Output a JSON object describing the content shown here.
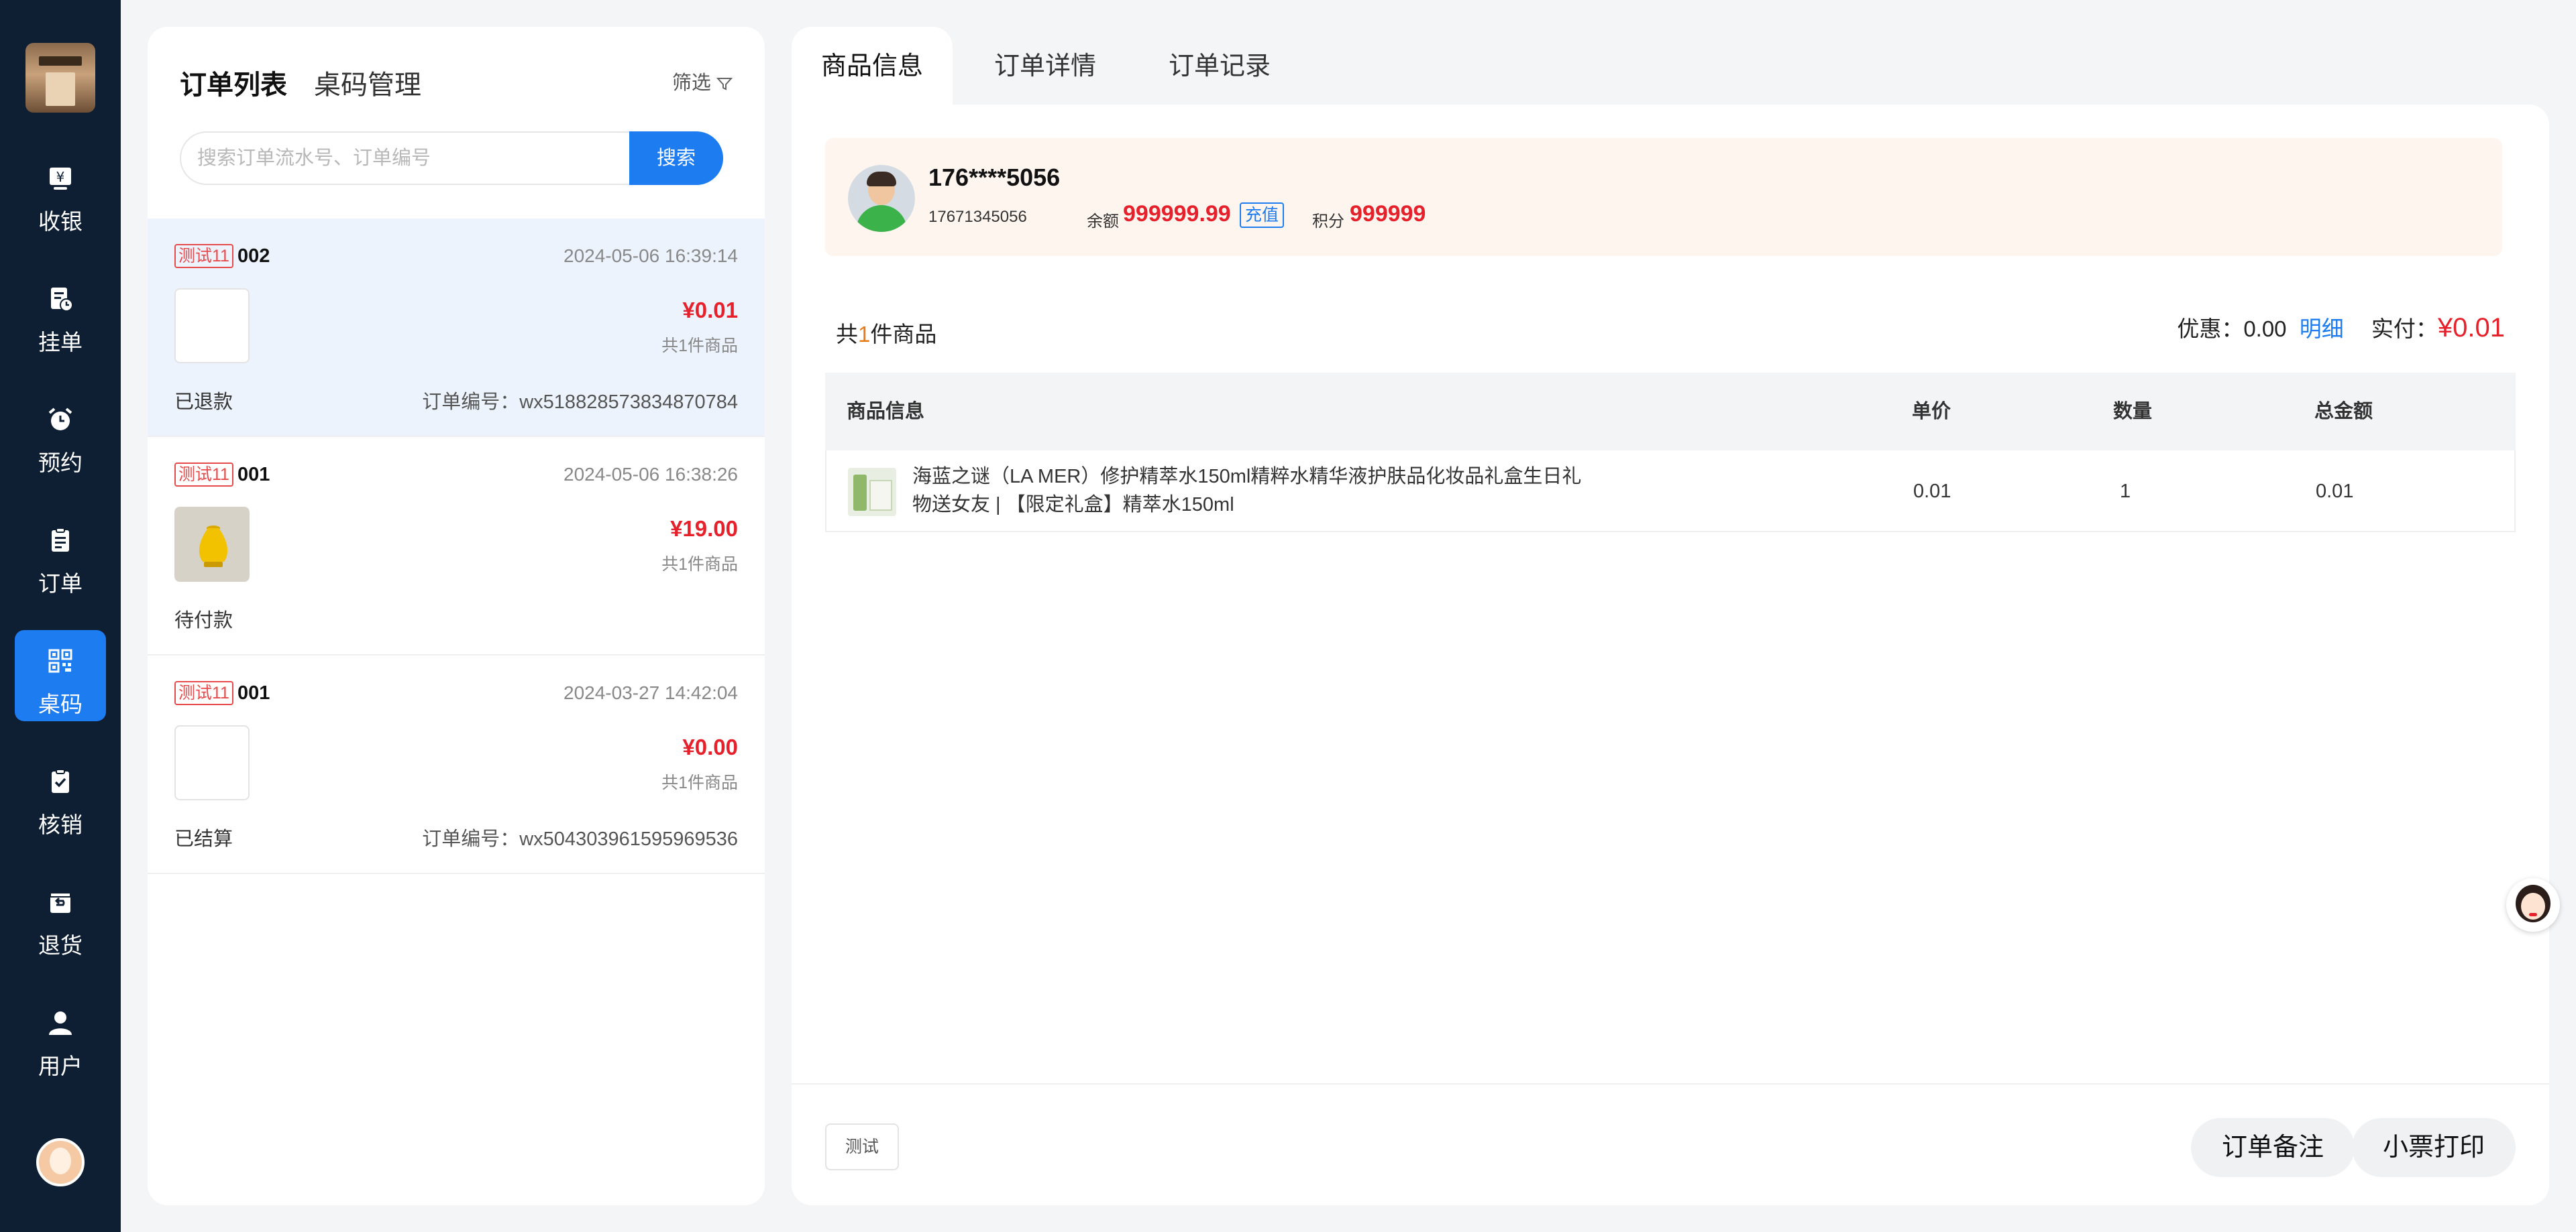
{
  "colors": {
    "accent": "#1c7cf0",
    "price": "#e6212b",
    "nav_bg": "#0f1f33",
    "member_bg": "#fff5ef"
  },
  "nav": {
    "items": [
      {
        "label": "收银",
        "icon": "cashier-yen-icon"
      },
      {
        "label": "挂单",
        "icon": "pending-order-icon"
      },
      {
        "label": "预约",
        "icon": "alarm-clock-icon"
      },
      {
        "label": "订单",
        "icon": "order-clipboard-icon"
      },
      {
        "label": "桌码",
        "icon": "qr-code-icon"
      },
      {
        "label": "核销",
        "icon": "verify-clipboard-icon"
      },
      {
        "label": "退货",
        "icon": "return-icon"
      },
      {
        "label": "用户",
        "icon": "user-icon"
      }
    ],
    "active": "桌码"
  },
  "left_panel": {
    "tab_orders": "订单列表",
    "tab_table": "桌码管理",
    "filter_label": "筛选",
    "search_placeholder": "搜索订单流水号、订单编号",
    "search_button": "搜索",
    "orders": [
      {
        "tag": "测试11",
        "num": "002",
        "time": "2024-05-06 16:39:14",
        "price": "¥0.01",
        "count": "共1件商品",
        "status": "已退款",
        "order_no": "订单编号：wx518828573834870784"
      },
      {
        "tag": "测试11",
        "num": "001",
        "time": "2024-05-06 16:38:26",
        "price": "¥19.00",
        "count": "共1件商品",
        "status": "待付款",
        "order_no": ""
      },
      {
        "tag": "测试11",
        "num": "001",
        "time": "2024-03-27 14:42:04",
        "price": "¥0.00",
        "count": "共1件商品",
        "status": "已结算",
        "order_no": "订单编号：wx504303961595969536"
      }
    ]
  },
  "right_panel": {
    "tabs": [
      "商品信息",
      "订单详情",
      "订单记录"
    ],
    "member": {
      "masked_phone": "176****5056",
      "phone": "17671345056",
      "balance_label": "余额",
      "balance": "999999.99",
      "recharge": "充值",
      "points_label": "积分",
      "points": "999999"
    },
    "summary": {
      "prefix": "共",
      "count": "1",
      "suffix": "件商品",
      "discount_label": "优惠：",
      "discount": "0.00",
      "detail": "明细",
      "paid_label": "实付：",
      "paid": "¥0.01"
    },
    "table": {
      "headers": [
        "商品信息",
        "单价",
        "数量",
        "总金额"
      ],
      "rows": [
        {
          "name": "海蓝之谜（LA MER）修护精萃水150ml精粹水精华液护肤品化妆品礼盒生日礼物送女友 | 【限定礼盒】精萃水150ml",
          "unit_price": "0.01",
          "qty": "1",
          "total": "0.01"
        }
      ]
    },
    "footer": {
      "note_tag": "测试",
      "btn_remark": "订单备注",
      "btn_print": "小票打印"
    }
  }
}
